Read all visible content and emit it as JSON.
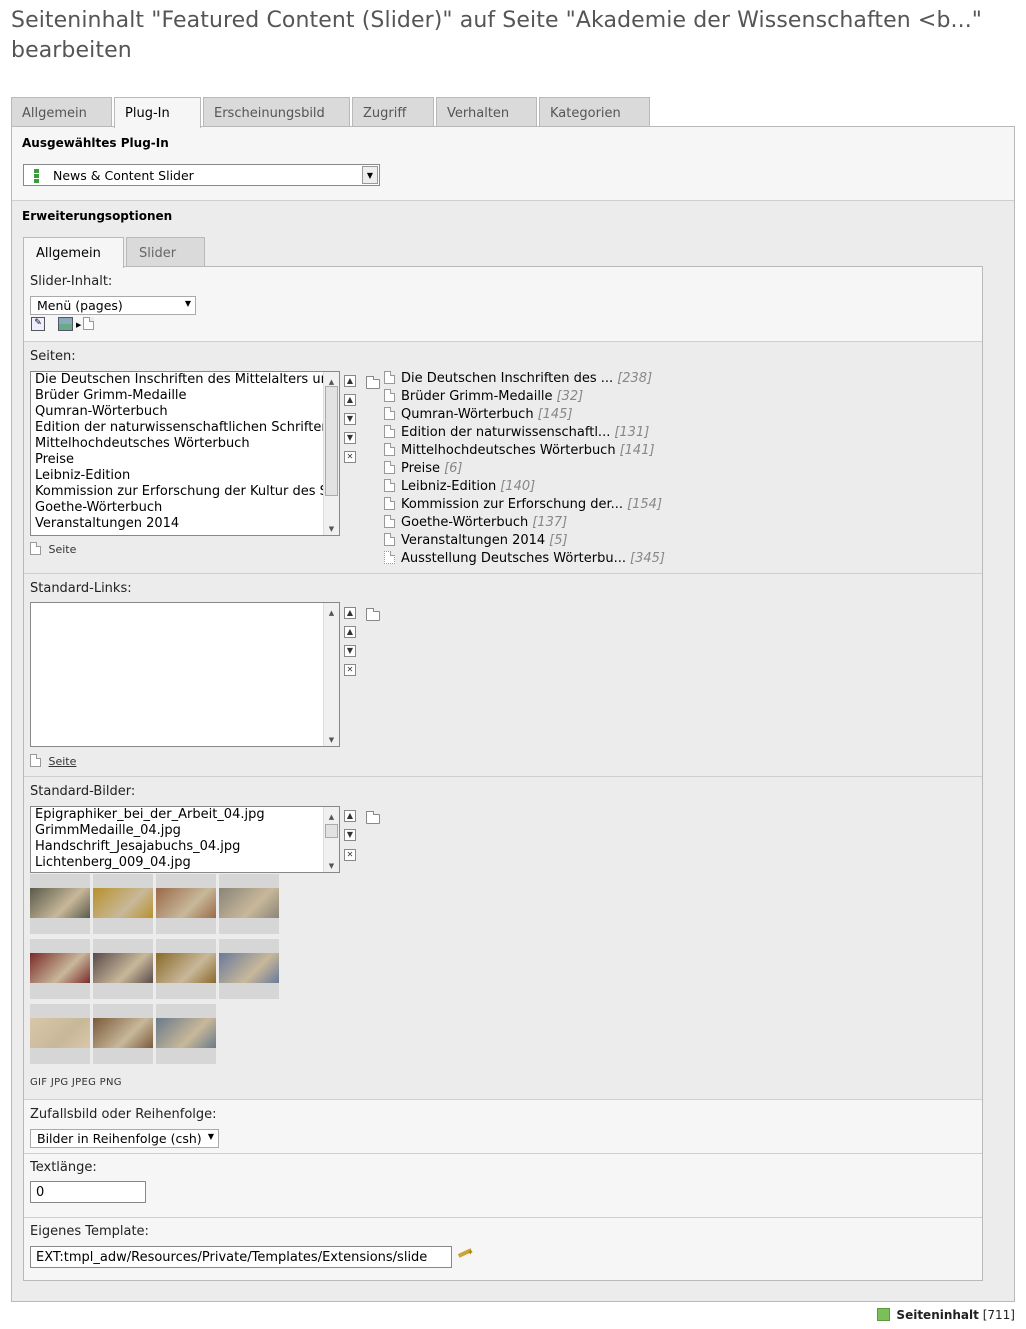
{
  "page_title": "Seiteninhalt \"Featured Content (Slider)\" auf Seite \"Akademie der Wissenschaften <b...\" bearbeiten",
  "tabs": [
    "Allgemein",
    "Plug-In",
    "Erscheinungsbild",
    "Zugriff",
    "Verhalten",
    "Kategorien"
  ],
  "active_tab": "Plug-In",
  "plugin": {
    "label": "Ausgewähltes Plug-In",
    "selected": "News & Content Slider"
  },
  "options_label": "Erweiterungsoptionen",
  "subtabs": [
    "Allgemein",
    "Slider"
  ],
  "slider_content": {
    "label": "Slider-Inhalt:",
    "selected": "Menü (pages)"
  },
  "seiten": {
    "label": "Seiten:",
    "items": [
      "Die Deutschen Inschriften des Mittelalters und",
      "Brüder Grimm-Medaille",
      "Qumran-Wörterbuch",
      "Edition der naturwissenschaftlichen Schriften",
      "Mittelhochdeutsches Wörterbuch",
      "Preise",
      "Leibniz-Edition",
      "Kommission zur Erforschung der Kultur des Sp",
      "Goethe-Wörterbuch",
      "Veranstaltungen 2014"
    ],
    "refs": [
      {
        "title": "Die Deutschen Inschriften des ...",
        "count": "[238]"
      },
      {
        "title": "Brüder Grimm-Medaille",
        "count": "[32]"
      },
      {
        "title": "Qumran-Wörterbuch",
        "count": "[145]"
      },
      {
        "title": "Edition der naturwissenschaftl...",
        "count": "[131]"
      },
      {
        "title": "Mittelhochdeutsches Wörterbuch",
        "count": "[141]"
      },
      {
        "title": "Preise",
        "count": "[6]"
      },
      {
        "title": "Leibniz-Edition",
        "count": "[140]"
      },
      {
        "title": "Kommission zur Erforschung der...",
        "count": "[154]"
      },
      {
        "title": "Goethe-Wörterbuch",
        "count": "[137]"
      },
      {
        "title": "Veranstaltungen 2014",
        "count": "[5]"
      },
      {
        "title": "Ausstellung Deutsches Wörterbu...",
        "count": "[345]"
      }
    ],
    "add_link": "Seite"
  },
  "standard_links": {
    "label": "Standard-Links:",
    "add_link": "Seite"
  },
  "standard_bilder": {
    "label": "Standard-Bilder:",
    "items": [
      "Epigraphiker_bei_der_Arbeit_04.jpg",
      "GrimmMedaille_04.jpg",
      "Handschrift_Jesajabuchs_04.jpg",
      "Lichtenberg_009_04.jpg"
    ],
    "thumbnail_colors": [
      [
        "#5a5a4a",
        "#b8912a",
        "#9a6a4a",
        "#8a8478"
      ],
      [
        "#7a2a2a",
        "#5a4a4a",
        "#8a6a2a",
        "#6a7a9a"
      ],
      [
        "#d8c8a8",
        "#7a5a3a",
        "#6a7a8a"
      ]
    ],
    "file_types": "GIF JPG JPEG PNG"
  },
  "zufall": {
    "label": "Zufallsbild oder Reihenfolge:",
    "selected": "Bilder in Reihenfolge (csh)"
  },
  "textlaenge": {
    "label": "Textlänge:",
    "value": "0"
  },
  "template": {
    "label": "Eigenes Template:",
    "value": "EXT:tmpl_adw/Resources/Private/Templates/Extensions/slide"
  },
  "footer": {
    "label": "Seiteninhalt",
    "id": "[711]"
  }
}
